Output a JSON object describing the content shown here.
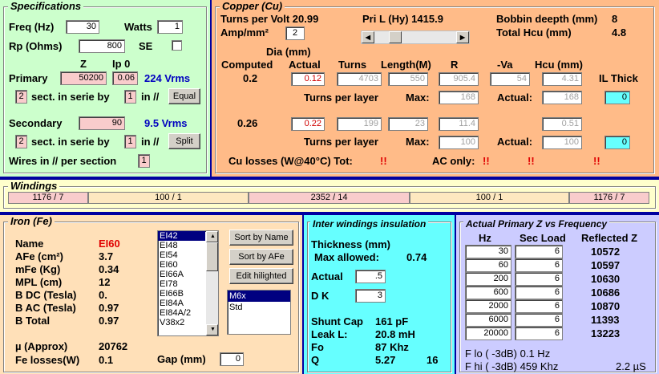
{
  "spec": {
    "title": "Specifications",
    "freq_label": "Freq (Hz)",
    "freq_value": "30",
    "watts_label": "Watts",
    "watts_value": "1",
    "rp_label": "Rp (Ohms)",
    "rp_value": "800",
    "se_label": "SE",
    "z_header": "Z",
    "ip0_header": "Ip 0",
    "primary_label": "Primary",
    "primary_z": "50200",
    "primary_ip0": "0.06",
    "primary_vrms": "224 Vrms",
    "primary_sect": "2",
    "sect_text": "sect. in serie by",
    "primary_par": "1",
    "in_par_text": "in //",
    "equal_button": "Equal",
    "secondary_label": "Secondary",
    "secondary_z": "90",
    "secondary_vrms": "9.5 Vrms",
    "secondary_sect": "2",
    "secondary_par": "1",
    "split_button": "Split",
    "wires_label": "Wires in // per section",
    "wires_value": "1"
  },
  "copper": {
    "title": "Copper (Cu)",
    "turns_per_volt": "Turns per Volt  20.99",
    "pri_l": "Pri L (Hy)  1415.9",
    "bobbin_label": "Bobbin deepth (mm)",
    "bobbin_value": "8",
    "amp_label": "Amp/mm²",
    "amp_value": "2",
    "total_hcu_label": "Total Hcu (mm)",
    "total_hcu_value": "4.8",
    "dia_label": "Dia (mm)",
    "h_computed": "Computed",
    "h_actual": "Actual",
    "h_turns": "Turns",
    "h_length": "Length(M)",
    "h_r": "R",
    "h_va": "-Va",
    "h_hcu": "Hcu (mm)",
    "h_ilthick": "IL Thick",
    "pri_computed": "0.2",
    "pri_actual": "0.12",
    "pri_turns": "4703",
    "pri_length": "550",
    "pri_r": "905.4",
    "pri_va": "54",
    "pri_hcu": "4.31",
    "tpl_label": "Turns per layer",
    "max_label": "Max:",
    "actual_label": "Actual:",
    "pri_max": "168",
    "pri_act": "168",
    "pri_il": "0",
    "sec_computed": "0.26",
    "sec_actual": "0.22",
    "sec_turns": "199",
    "sec_length": "23",
    "sec_r": "11.4",
    "sec_hcu": "0.51",
    "sec_max": "100",
    "sec_act": "100",
    "sec_il": "0",
    "cu_losses_label": "Cu losses (W@40°C) Tot:",
    "cu_tot": "!!",
    "ac_only_label": "AC only:",
    "ac_1": "!!",
    "ac_2": "!!",
    "ac_3": "!!"
  },
  "windings": {
    "title": "Windings",
    "segments": [
      "1176 / 7",
      "100 / 1",
      "2352 / 14",
      "100 / 1",
      "1176 / 7"
    ],
    "colors": [
      "#f9cccc",
      "#fde8c0",
      "#f9cccc",
      "#fde8c0",
      "#f9cccc"
    ]
  },
  "iron": {
    "title": "Iron (Fe)",
    "name_label": "Name",
    "name_value": "EI60",
    "afe_label": "AFe (cm²)",
    "afe_value": "3.7",
    "mfe_label": "mFe (Kg)",
    "mfe_value": "0.34",
    "mpl_label": "MPL (cm)",
    "mpl_value": "12",
    "bdc_label": "B DC (Tesla)",
    "bdc_value": "0.",
    "bac_label": "B AC (Tesla)",
    "bac_value": "0.97",
    "btot_label": "B Total",
    "btot_value": "0.97",
    "mu_label": "µ (Approx)",
    "mu_value": "20762",
    "felosses_label": "Fe losses(W)",
    "felosses_value": "0.1",
    "gap_label": "Gap (mm)",
    "gap_value": "0",
    "core_list": [
      "EI42",
      "EI48",
      "EI54",
      "EI60",
      "EI66A",
      "EI78",
      "EI66B",
      "EI84A",
      "EI84A/2",
      "V38x2"
    ],
    "sort_name_button": "Sort by Name",
    "sort_afe_button": "Sort by AFe",
    "edit_button": "Edit hilighted",
    "material_list": [
      "M6x",
      "Std"
    ]
  },
  "insulation": {
    "title": "Inter windings insulation",
    "thickness_label": "Thickness (mm)",
    "max_allowed_label": "Max allowed:",
    "max_allowed_value": "0.74",
    "actual_label": "Actual",
    "actual_value": ".5",
    "dk_label": "D K",
    "dk_value": "3",
    "shunt_label": "Shunt Cap",
    "shunt_value": "161 pF",
    "leak_label": "Leak L:",
    "leak_value": "20.8 mH",
    "fo_label": "Fo",
    "fo_value": "87 Khz",
    "q_label": "Q",
    "q_value": "5.27",
    "q_extra": "16"
  },
  "zfreq": {
    "title": "Actual Primary Z vs Frequency",
    "h_hz": "Hz",
    "h_secload": "Sec Load",
    "h_reflected": "Reflected Z",
    "rows": [
      {
        "hz": "30",
        "load": "6",
        "z": "10572"
      },
      {
        "hz": "60",
        "load": "6",
        "z": "10597"
      },
      {
        "hz": "200",
        "load": "6",
        "z": "10630"
      },
      {
        "hz": "600",
        "load": "6",
        "z": "10686"
      },
      {
        "hz": "2000",
        "load": "6",
        "z": "10870"
      },
      {
        "hz": "6000",
        "load": "6",
        "z": "11393"
      },
      {
        "hz": "20000",
        "load": "6",
        "z": "13223"
      }
    ],
    "flo": "F lo ( -3dB) 0.1 Hz",
    "fhi": "F hi ( -3dB) 459 Khz",
    "rise": "2.2 µS"
  },
  "colors": {
    "spec_bg": "#ccffcc",
    "copper_bg": "#ffbb88",
    "windings_bg": "#ffffcc",
    "iron_bg": "#ffe0b8",
    "insul_bg": "#66ffff",
    "zfreq_bg": "#ccccff"
  }
}
